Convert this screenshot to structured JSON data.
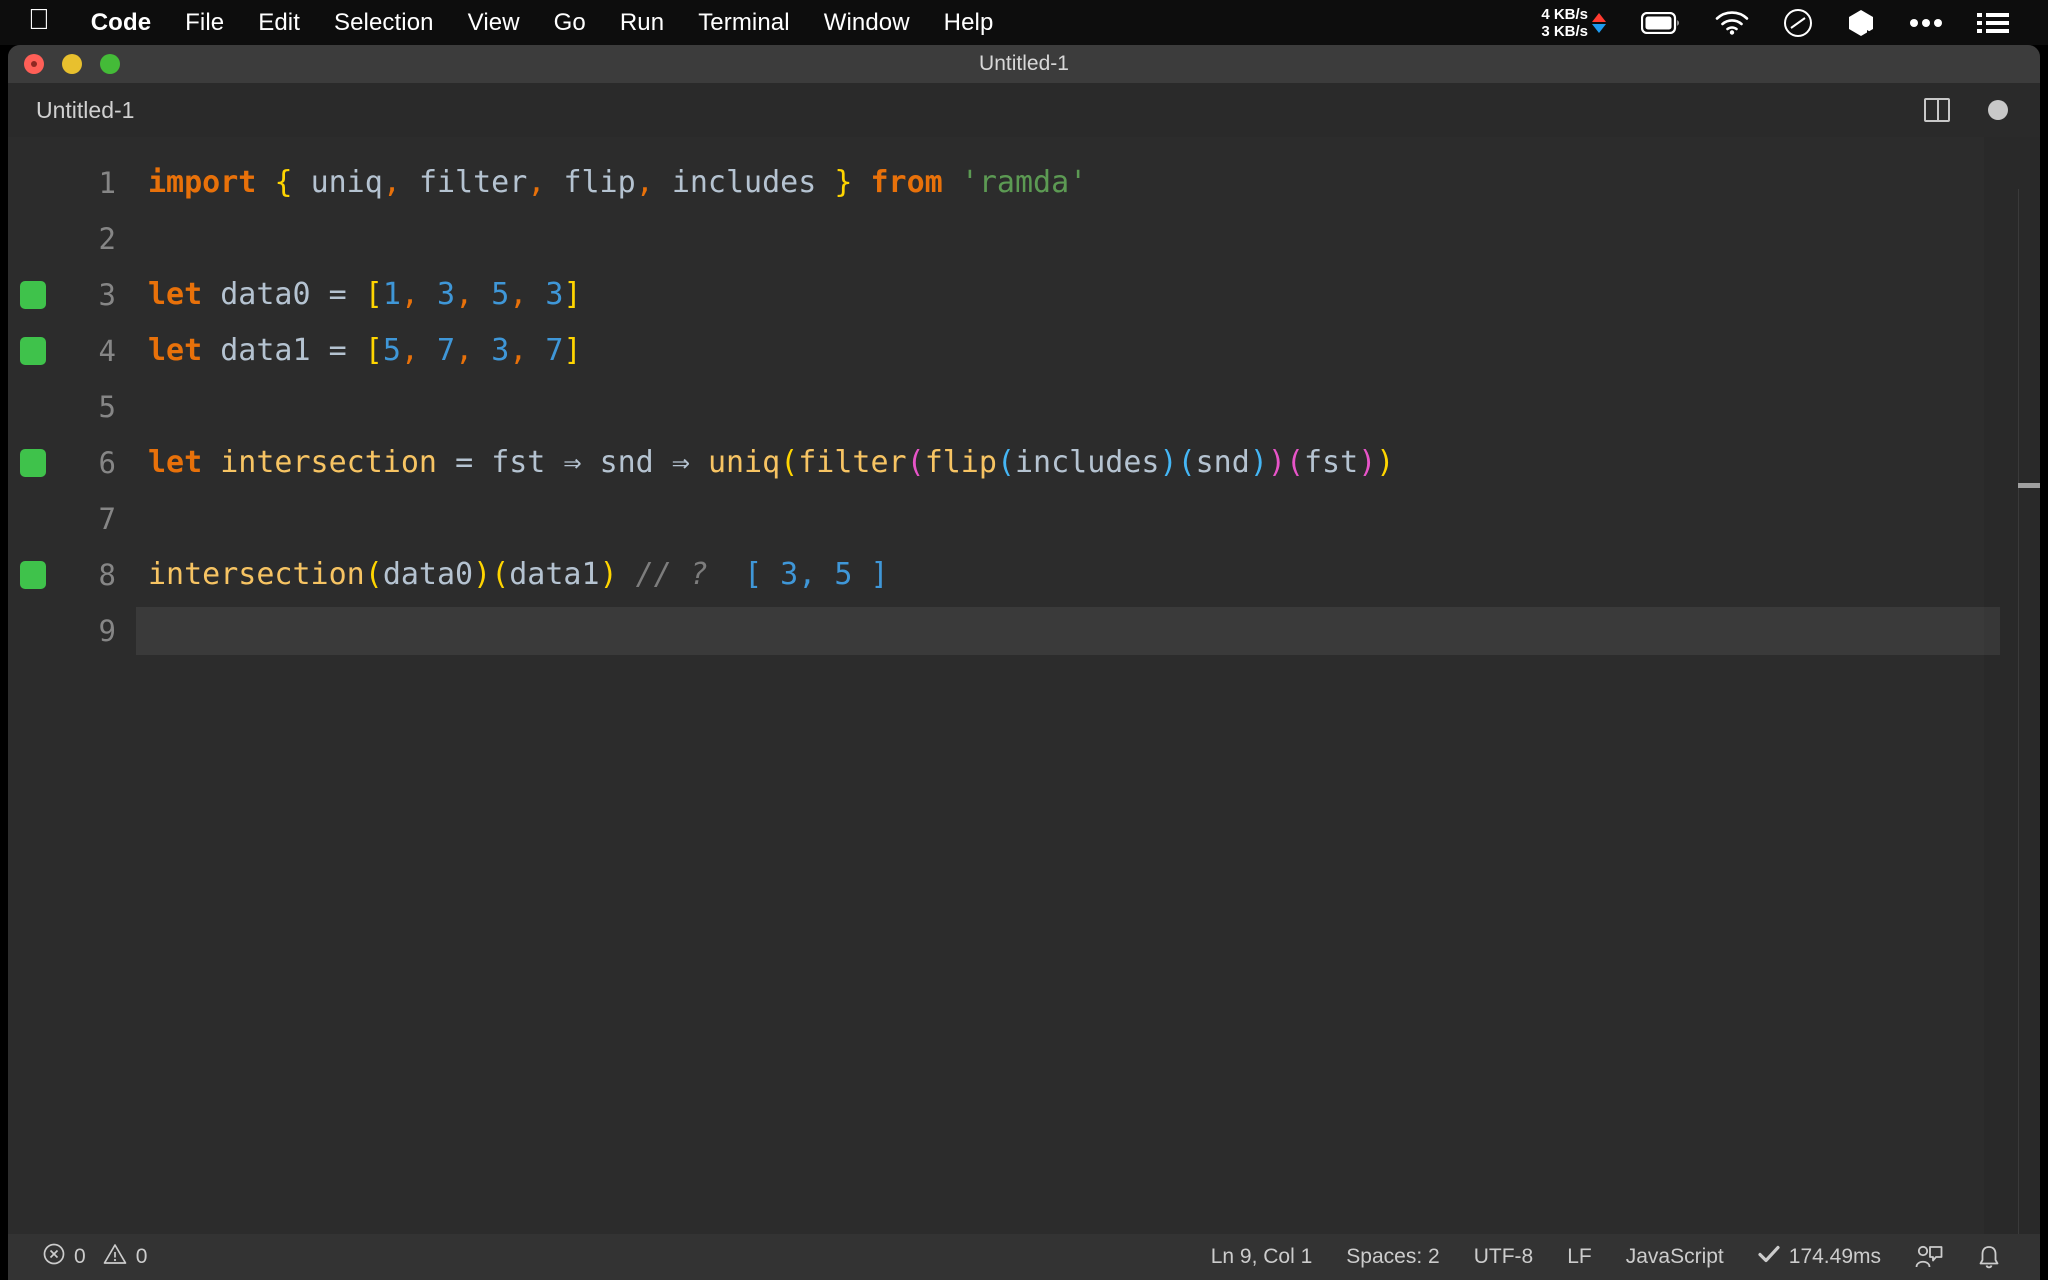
{
  "menubar": {
    "apple_icon": "apple-logo-icon",
    "items": [
      {
        "label": "Code",
        "bold": true
      },
      {
        "label": "File",
        "bold": false
      },
      {
        "label": "Edit",
        "bold": false
      },
      {
        "label": "Selection",
        "bold": false
      },
      {
        "label": "View",
        "bold": false
      },
      {
        "label": "Go",
        "bold": false
      },
      {
        "label": "Run",
        "bold": false
      },
      {
        "label": "Terminal",
        "bold": false
      },
      {
        "label": "Window",
        "bold": false
      },
      {
        "label": "Help",
        "bold": false
      }
    ],
    "network": {
      "upload": "4 KB/s",
      "download": "3 KB/s"
    },
    "status_icons": [
      "battery-icon",
      "wifi-icon",
      "control-center-icon",
      "dropbox-icon",
      "ellipsis-icon",
      "list-menu-icon"
    ]
  },
  "window": {
    "title": "Untitled-1",
    "traffic_lights": [
      "close-button",
      "minimize-button",
      "maximize-button"
    ]
  },
  "tabbar": {
    "tab_label": "Untitled-1",
    "split_editor_icon": "split-editor-icon",
    "dirty_indicator": "unsaved-dot-icon"
  },
  "editor": {
    "lines": [
      {
        "n": "1",
        "modified": false,
        "cursor": false,
        "tokens": [
          {
            "t": "import",
            "c": "kw"
          },
          {
            "t": " ",
            "c": "op"
          },
          {
            "t": "{",
            "c": "b0"
          },
          {
            "t": " ",
            "c": "id"
          },
          {
            "t": "uniq",
            "c": "id"
          },
          {
            "t": ",",
            "c": "punct"
          },
          {
            "t": " ",
            "c": "id"
          },
          {
            "t": "filter",
            "c": "id"
          },
          {
            "t": ",",
            "c": "punct"
          },
          {
            "t": " ",
            "c": "id"
          },
          {
            "t": "flip",
            "c": "id"
          },
          {
            "t": ",",
            "c": "punct"
          },
          {
            "t": " ",
            "c": "id"
          },
          {
            "t": "includes",
            "c": "id"
          },
          {
            "t": " ",
            "c": "id"
          },
          {
            "t": "}",
            "c": "b0"
          },
          {
            "t": " ",
            "c": "op"
          },
          {
            "t": "from",
            "c": "kw"
          },
          {
            "t": " ",
            "c": "op"
          },
          {
            "t": "'ramda'",
            "c": "str"
          }
        ]
      },
      {
        "n": "2",
        "modified": false,
        "cursor": false,
        "tokens": []
      },
      {
        "n": "3",
        "modified": true,
        "cursor": false,
        "tokens": [
          {
            "t": "let",
            "c": "kw"
          },
          {
            "t": " ",
            "c": "op"
          },
          {
            "t": "data0",
            "c": "id"
          },
          {
            "t": " ",
            "c": "op"
          },
          {
            "t": "=",
            "c": "op"
          },
          {
            "t": " ",
            "c": "op"
          },
          {
            "t": "[",
            "c": "b0"
          },
          {
            "t": "1",
            "c": "num"
          },
          {
            "t": ",",
            "c": "punct"
          },
          {
            "t": " ",
            "c": "op"
          },
          {
            "t": "3",
            "c": "num"
          },
          {
            "t": ",",
            "c": "punct"
          },
          {
            "t": " ",
            "c": "op"
          },
          {
            "t": "5",
            "c": "num"
          },
          {
            "t": ",",
            "c": "punct"
          },
          {
            "t": " ",
            "c": "op"
          },
          {
            "t": "3",
            "c": "num"
          },
          {
            "t": "]",
            "c": "b0"
          }
        ]
      },
      {
        "n": "4",
        "modified": true,
        "cursor": false,
        "tokens": [
          {
            "t": "let",
            "c": "kw"
          },
          {
            "t": " ",
            "c": "op"
          },
          {
            "t": "data1",
            "c": "id"
          },
          {
            "t": " ",
            "c": "op"
          },
          {
            "t": "=",
            "c": "op"
          },
          {
            "t": " ",
            "c": "op"
          },
          {
            "t": "[",
            "c": "b0"
          },
          {
            "t": "5",
            "c": "num"
          },
          {
            "t": ",",
            "c": "punct"
          },
          {
            "t": " ",
            "c": "op"
          },
          {
            "t": "7",
            "c": "num"
          },
          {
            "t": ",",
            "c": "punct"
          },
          {
            "t": " ",
            "c": "op"
          },
          {
            "t": "3",
            "c": "num"
          },
          {
            "t": ",",
            "c": "punct"
          },
          {
            "t": " ",
            "c": "op"
          },
          {
            "t": "7",
            "c": "num"
          },
          {
            "t": "]",
            "c": "b0"
          }
        ]
      },
      {
        "n": "5",
        "modified": false,
        "cursor": false,
        "tokens": []
      },
      {
        "n": "6",
        "modified": true,
        "cursor": false,
        "tokens": [
          {
            "t": "let",
            "c": "kw"
          },
          {
            "t": " ",
            "c": "op"
          },
          {
            "t": "intersection",
            "c": "fn"
          },
          {
            "t": " ",
            "c": "op"
          },
          {
            "t": "=",
            "c": "op"
          },
          {
            "t": " ",
            "c": "op"
          },
          {
            "t": "fst",
            "c": "id"
          },
          {
            "t": " ",
            "c": "op"
          },
          {
            "t": "⇒",
            "c": "op"
          },
          {
            "t": " ",
            "c": "op"
          },
          {
            "t": "snd",
            "c": "id"
          },
          {
            "t": " ",
            "c": "op"
          },
          {
            "t": "⇒",
            "c": "op"
          },
          {
            "t": " ",
            "c": "op"
          },
          {
            "t": "uniq",
            "c": "fn"
          },
          {
            "t": "(",
            "c": "b0"
          },
          {
            "t": "filter",
            "c": "fn"
          },
          {
            "t": "(",
            "c": "b1"
          },
          {
            "t": "flip",
            "c": "fn"
          },
          {
            "t": "(",
            "c": "b2"
          },
          {
            "t": "includes",
            "c": "id"
          },
          {
            "t": ")",
            "c": "b2"
          },
          {
            "t": "(",
            "c": "b2"
          },
          {
            "t": "snd",
            "c": "id"
          },
          {
            "t": ")",
            "c": "b2"
          },
          {
            "t": ")",
            "c": "b1"
          },
          {
            "t": "(",
            "c": "b1"
          },
          {
            "t": "fst",
            "c": "id"
          },
          {
            "t": ")",
            "c": "b1"
          },
          {
            "t": ")",
            "c": "b0"
          }
        ]
      },
      {
        "n": "7",
        "modified": false,
        "cursor": false,
        "tokens": []
      },
      {
        "n": "8",
        "modified": true,
        "cursor": false,
        "tokens": [
          {
            "t": "intersection",
            "c": "fn"
          },
          {
            "t": "(",
            "c": "b0"
          },
          {
            "t": "data0",
            "c": "id"
          },
          {
            "t": ")",
            "c": "b0"
          },
          {
            "t": "(",
            "c": "b0"
          },
          {
            "t": "data1",
            "c": "id"
          },
          {
            "t": ")",
            "c": "b0"
          },
          {
            "t": " ",
            "c": "op"
          },
          {
            "t": "// ?",
            "c": "com"
          },
          {
            "t": "  ",
            "c": "op"
          },
          {
            "t": "[ 3, 5 ]",
            "c": "res"
          }
        ]
      },
      {
        "n": "9",
        "modified": false,
        "cursor": true,
        "tokens": []
      }
    ]
  },
  "statusbar": {
    "errors_icon": "error-circle-icon",
    "errors": "0",
    "warnings_icon": "warning-triangle-icon",
    "warnings": "0",
    "cursor_position": "Ln 9, Col 1",
    "indentation": "Spaces: 2",
    "encoding": "UTF-8",
    "eol": "LF",
    "language": "JavaScript",
    "check_icon": "checkmark-icon",
    "runtime": "174.49ms",
    "liveshare_icon": "live-share-icon",
    "bell_icon": "bell-icon"
  }
}
